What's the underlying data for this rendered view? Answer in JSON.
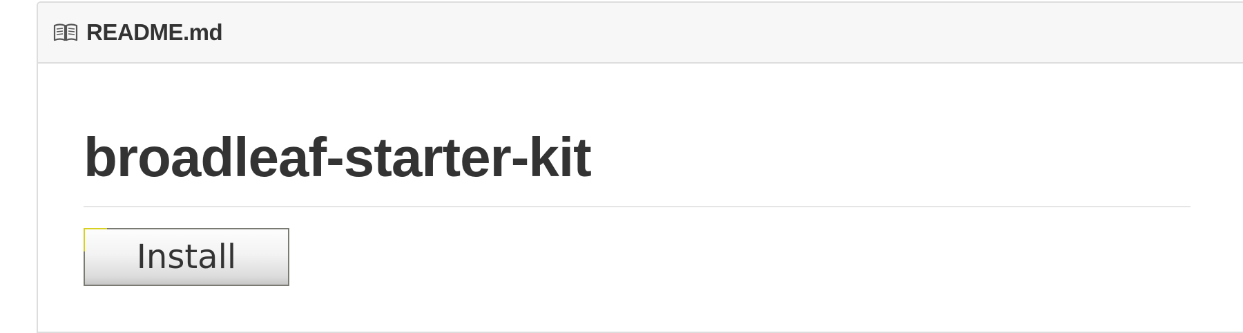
{
  "readme": {
    "icon": "book-icon",
    "filename": "README.md"
  },
  "content": {
    "title": "broadleaf-starter-kit",
    "install_button_label": "Install"
  },
  "colors": {
    "header_background": "#f7f7f7",
    "border": "#dddddd",
    "text": "#333333",
    "button_corner_accent": "#d8d020"
  }
}
